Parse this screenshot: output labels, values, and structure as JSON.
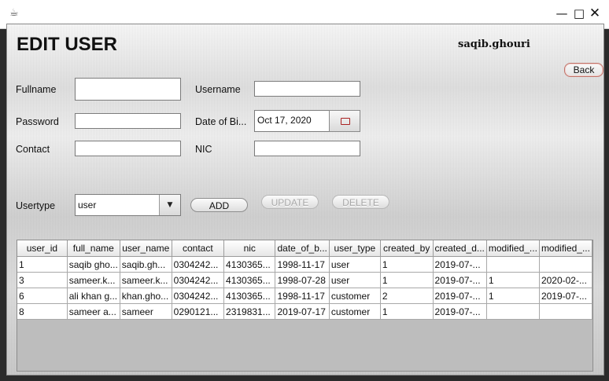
{
  "window": {
    "app_icon": "coffee-cup-icon",
    "minimize": "—",
    "maximize": "□",
    "close": "✕"
  },
  "header": {
    "title": "EDIT USER",
    "current_user": "saqib.ghouri",
    "back_label": "Back"
  },
  "form": {
    "fullname": {
      "label": "Fullname",
      "value": ""
    },
    "username": {
      "label": "Username",
      "value": ""
    },
    "password": {
      "label": "Password",
      "value": ""
    },
    "dob": {
      "label": "Date of Bi...",
      "value": "Oct 17, 2020"
    },
    "contact": {
      "label": "Contact",
      "value": ""
    },
    "nic": {
      "label": "NIC",
      "value": ""
    },
    "usertype": {
      "label": "Usertype",
      "value": "user"
    }
  },
  "actions": {
    "add": "ADD",
    "update": "UPDATE",
    "delete": "DELETE"
  },
  "table": {
    "columns": [
      "user_id",
      "full_name",
      "user_name",
      "contact",
      "nic",
      "date_of_b...",
      "user_type",
      "created_by",
      "created_d...",
      "modified_...",
      "modified_..."
    ],
    "rows": [
      [
        "1",
        "saqib gho...",
        "saqib.gh...",
        "0304242...",
        "4130365...",
        "1998-11-17",
        "user",
        "1",
        "2019-07-...",
        "",
        ""
      ],
      [
        "3",
        "sameer.k...",
        "sameer.k...",
        "0304242...",
        "4130365...",
        "1998-07-28",
        "user",
        "1",
        "2019-07-...",
        "1",
        "2020-02-..."
      ],
      [
        "6",
        "ali khan g...",
        "khan.gho...",
        "0304242...",
        "4130365...",
        "1998-11-17",
        "customer",
        "2",
        "2019-07-...",
        "1",
        "2019-07-..."
      ],
      [
        "8",
        "sameer a...",
        "sameer",
        "0290121...",
        "2319831...",
        "2019-07-17",
        "customer",
        "1",
        "2019-07-...",
        "",
        ""
      ]
    ]
  },
  "colors": {
    "back_border": "#c0736a",
    "date_icon": "#aa2222"
  }
}
